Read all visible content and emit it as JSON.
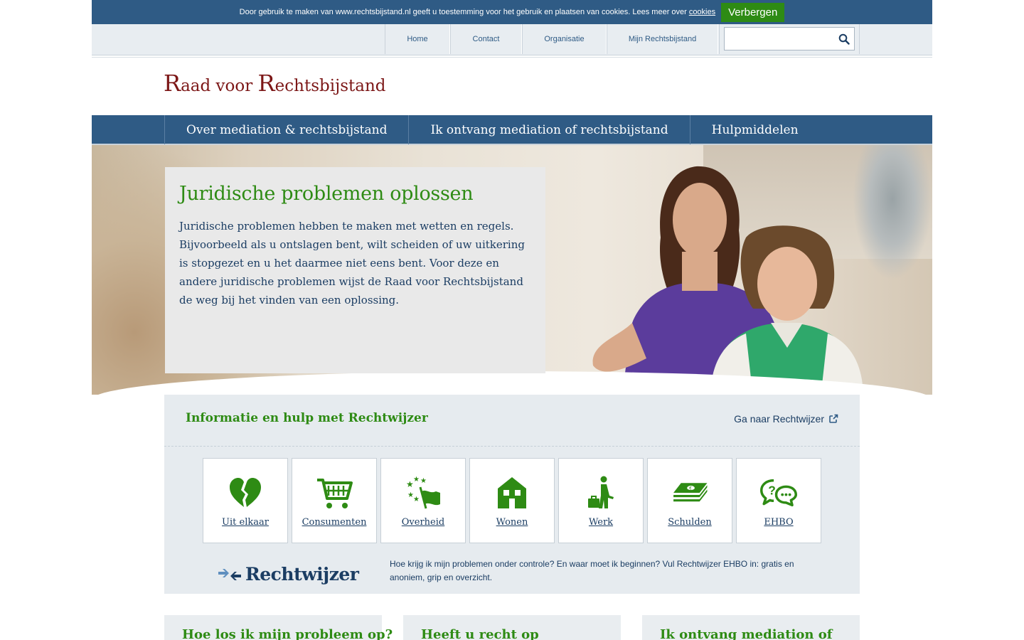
{
  "cookie_bar": {
    "text": "Door gebruik te maken van www.rechtsbijstand.nl geeft u toestemming voor het gebruik en plaatsen van cookies. Lees meer over",
    "link": "cookies",
    "button": "Verbergen"
  },
  "utility_nav": {
    "items": [
      "Home",
      "Contact",
      "Organisatie",
      "Mijn Rechtsbijstand"
    ],
    "search_placeholder": ""
  },
  "logo": {
    "word1_cap": "R",
    "word1_rest": "aad voor ",
    "word2_cap": "R",
    "word2_rest": "echtsbijstand"
  },
  "main_nav": {
    "items": [
      "Over mediation & rechtsbijstand",
      "Ik ontvang mediation of rechtsbijstand",
      "Hulpmiddelen"
    ]
  },
  "hero": {
    "title": "Juridische problemen oplossen",
    "text": "Juridische problemen hebben te maken met wetten en regels. Bijvoorbeeld als u ontslagen bent, wilt scheiden of uw uitkering is stopgezet en u het daarmee niet eens bent. Voor deze en andere juridische problemen wijst de Raad voor Rechtsbijstand de weg bij het vinden van een oplossing."
  },
  "rechtwijzer": {
    "title": "Informatie en hulp met Rechtwijzer",
    "goto": "Ga naar Rechtwijzer",
    "tiles": [
      {
        "label": "Uit elkaar",
        "icon": "broken-heart-icon"
      },
      {
        "label": "Consumenten",
        "icon": "shopping-cart-icon"
      },
      {
        "label": "Overheid",
        "icon": "eu-flag-icon"
      },
      {
        "label": "Wonen",
        "icon": "house-icon"
      },
      {
        "label": "Werk",
        "icon": "worker-briefcase-icon"
      },
      {
        "label": "Schulden",
        "icon": "money-stack-icon"
      },
      {
        "label": "EHBO",
        "icon": "question-chat-icon"
      }
    ],
    "logo_text": "Rechtwijzer",
    "description": "Hoe krijg ik mijn problemen onder controle? En waar moet ik beginnen? Vul Rechtwijzer EHBO in: gratis en anoniem, grip en overzicht."
  },
  "cards": [
    {
      "title": "Hoe los ik mijn probleem op?"
    },
    {
      "title": "Heeft u recht op"
    },
    {
      "title": "Ik ontvang mediation of"
    }
  ],
  "colors": {
    "primary_blue": "#2f5b85",
    "green": "#2e8b14",
    "logo_red": "#7c1717",
    "text_navy": "#1b3d63"
  }
}
